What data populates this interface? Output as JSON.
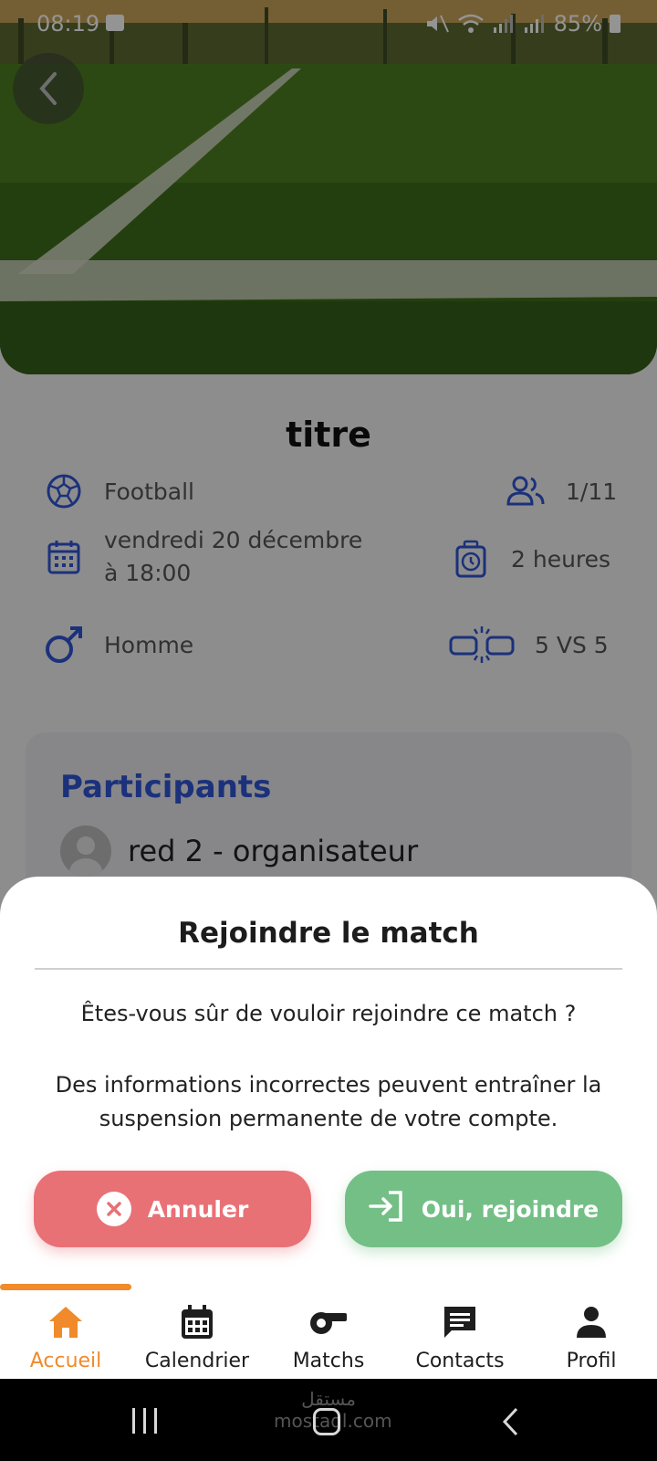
{
  "status_bar": {
    "time": "08:19",
    "battery": "85%"
  },
  "match": {
    "title": "titre",
    "sport": "Football",
    "players": "1/11",
    "date_line1": "vendredi 20 décembre",
    "date_line2": "à 18:00",
    "duration": "2 heures",
    "gender": "Homme",
    "format": "5 VS 5"
  },
  "participants": {
    "heading": "Participants",
    "items": [
      {
        "label": "red 2  - organisateur"
      }
    ]
  },
  "dialog": {
    "title": "Rejoindre le match",
    "question": "Êtes-vous sûr de vouloir rejoindre ce match ?",
    "warning": "Des informations incorrectes peuvent entraîner la suspension permanente de votre compte.",
    "cancel_label": "Annuler",
    "confirm_label": "Oui, rejoindre"
  },
  "bottom_nav": {
    "items": [
      {
        "label": "Accueil",
        "icon": "home-icon",
        "active": true
      },
      {
        "label": "Calendrier",
        "icon": "calendar-icon",
        "active": false
      },
      {
        "label": "Matchs",
        "icon": "whistle-icon",
        "active": false
      },
      {
        "label": "Contacts",
        "icon": "chat-icon",
        "active": false
      },
      {
        "label": "Profil",
        "icon": "person-icon",
        "active": false
      }
    ]
  },
  "system_nav": {
    "watermark": "مستقل mostaql.com"
  },
  "colors": {
    "accent_blue": "#2f55d4",
    "active_orange": "#f08a2a",
    "cancel_red": "#e87176",
    "confirm_green": "#73bf86"
  }
}
